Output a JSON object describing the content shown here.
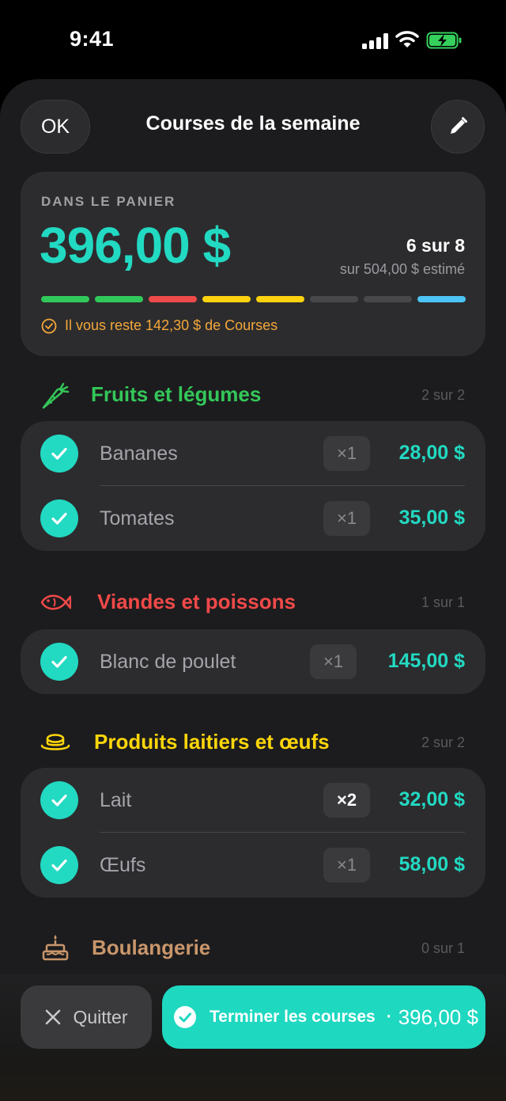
{
  "status_bar": {
    "time": "9:41",
    "icons": [
      "signal-icon",
      "wifi-icon",
      "battery-charging-icon"
    ]
  },
  "nav": {
    "ok_label": "OK",
    "title": "Courses de la semaine",
    "edit_icon": "pencil-icon"
  },
  "summary": {
    "label": "DANS LE PANIER",
    "amount": "396,00 $",
    "count": "6 sur 8",
    "estimate": "sur 504,00 $ estimé",
    "segments": [
      "#30c85a",
      "#30c85a",
      "#ef4a4a",
      "#fcd20f",
      "#fcd20f",
      "#48484a",
      "#48484a",
      "#4cc4f5"
    ],
    "remaining": "Il vous reste 142,30 $ de Courses"
  },
  "categories": [
    {
      "title": "Fruits et légumes",
      "count": "2 sur 2",
      "color": "#34c759",
      "icon": "carrot-icon",
      "items": [
        {
          "name": "Bananes",
          "qty": "×1",
          "price": "28,00 $"
        },
        {
          "name": "Tomates",
          "qty": "×1",
          "price": "35,00 $"
        }
      ]
    },
    {
      "title": "Viandes et poissons",
      "count": "1 sur 1",
      "color": "#f24949",
      "icon": "fish-icon",
      "items": [
        {
          "name": "Blanc de poulet",
          "qty": "×1",
          "price": "145,00 $"
        }
      ]
    },
    {
      "title": "Produits laitiers et œufs",
      "count": "2 sur 2",
      "color": "#ffd60a",
      "icon": "dish-icon",
      "items": [
        {
          "name": "Lait",
          "qty": "×2",
          "price": "32,00 $"
        },
        {
          "name": "Œufs",
          "qty": "×1",
          "price": "58,00 $"
        }
      ]
    },
    {
      "title": "Boulangerie",
      "count": "0 sur 1",
      "color": "#c9966b",
      "icon": "cake-icon",
      "items": []
    }
  ],
  "footer": {
    "quit_label": "Quitter",
    "finish_label": "Terminer les courses",
    "separator": "·",
    "total": "396,00 $"
  }
}
